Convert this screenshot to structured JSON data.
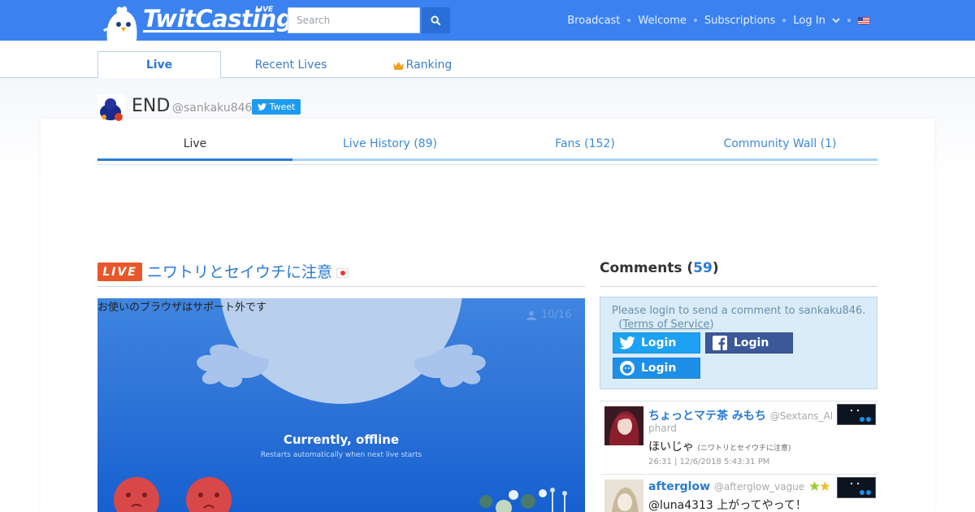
{
  "header": {
    "brand": "TwitCasting",
    "brand_badge": "LIVE",
    "search_placeholder": "Search",
    "nav": [
      "Broadcast",
      "Welcome",
      "Subscriptions",
      "Log In"
    ]
  },
  "subnav": {
    "tabs": [
      "Live",
      "Recent Lives",
      "Ranking"
    ]
  },
  "profile": {
    "name": "END",
    "handle": "@sankaku846",
    "tweet_label": "Tweet",
    "tabs": [
      "Live",
      "Live History (89)",
      "Fans (152)",
      "Community Wall (1)"
    ]
  },
  "live": {
    "badge": "LIVE",
    "title": "ニワトリとセイウチに注意",
    "unsupported_notice": "お使いのブラウザはサポート外です",
    "viewers": "10/16",
    "offline_title": "Currently, offline",
    "offline_sub": "Restarts automatically when next live starts"
  },
  "comments": {
    "title": "Comments",
    "count": "59",
    "login_prompt": "Please login to send a comment to sankaku846.",
    "terms_label": "Terms of Service",
    "login_label": "Login",
    "items": [
      {
        "name": "ちょっとマテ茶 みもち",
        "handle": "@Sextans_Al",
        "handle_cont": "phard",
        "text": "ほいじゃ",
        "tag": "(ニワトリとセイウチに注意)",
        "time": "26:31 | 12/6/2018 5:43:31 PM"
      },
      {
        "name": "afterglow",
        "handle": "@afterglow_vague",
        "text": "@luna4313 上がってやって！"
      }
    ]
  },
  "colors": {
    "header_bg": "#3b82f0",
    "accent": "#2a7ad6",
    "live_badge": "#e8572a",
    "twitter": "#1da1f2",
    "facebook": "#3b5998"
  }
}
